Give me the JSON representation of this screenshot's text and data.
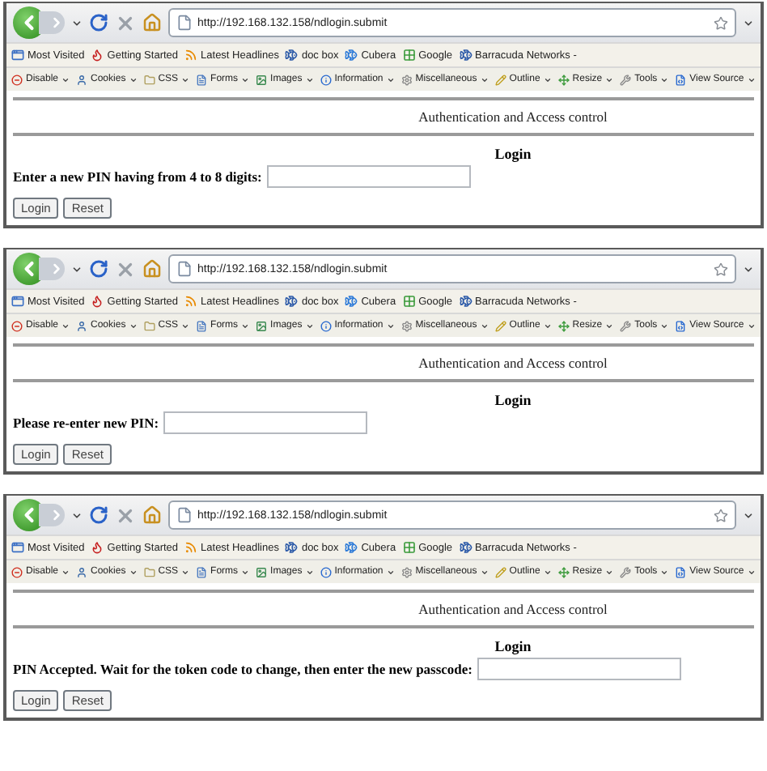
{
  "panels": [
    {
      "url": "http://192.168.132.158/ndlogin.submit",
      "bookmarks": [
        "Most Visited",
        "Getting Started",
        "Latest Headlines",
        "doc box",
        "Cubera",
        "Google",
        "Barracuda Networks -"
      ],
      "tools": [
        "Disable",
        "Cookies",
        "CSS",
        "Forms",
        "Images",
        "Information",
        "Miscellaneous",
        "Outline",
        "Resize",
        "Tools",
        "View Source"
      ],
      "page_title": "Authentication and Access control",
      "heading": "Login",
      "prompt": "Enter a new PIN having from 4 to 8 digits:",
      "buttons": [
        "Login",
        "Reset"
      ]
    },
    {
      "url": "http://192.168.132.158/ndlogin.submit",
      "bookmarks": [
        "Most Visited",
        "Getting Started",
        "Latest Headlines",
        "doc box",
        "Cubera",
        "Google",
        "Barracuda Networks -"
      ],
      "tools": [
        "Disable",
        "Cookies",
        "CSS",
        "Forms",
        "Images",
        "Information",
        "Miscellaneous",
        "Outline",
        "Resize",
        "Tools",
        "View Source"
      ],
      "page_title": "Authentication and Access control",
      "heading": "Login",
      "prompt": "Please re-enter new PIN:",
      "buttons": [
        "Login",
        "Reset"
      ]
    },
    {
      "url": "http://192.168.132.158/ndlogin.submit",
      "bookmarks": [
        "Most Visited",
        "Getting Started",
        "Latest Headlines",
        "doc box",
        "Cubera",
        "Google",
        "Barracuda Networks -"
      ],
      "tools": [
        "Disable",
        "Cookies",
        "CSS",
        "Forms",
        "Images",
        "Information",
        "Miscellaneous",
        "Outline",
        "Resize",
        "Tools",
        "View Source"
      ],
      "page_title": "Authentication and Access control",
      "heading": "Login",
      "prompt": "PIN Accepted. Wait for the token code to change, then enter the new passcode:",
      "buttons": [
        "Login",
        "Reset"
      ]
    }
  ]
}
